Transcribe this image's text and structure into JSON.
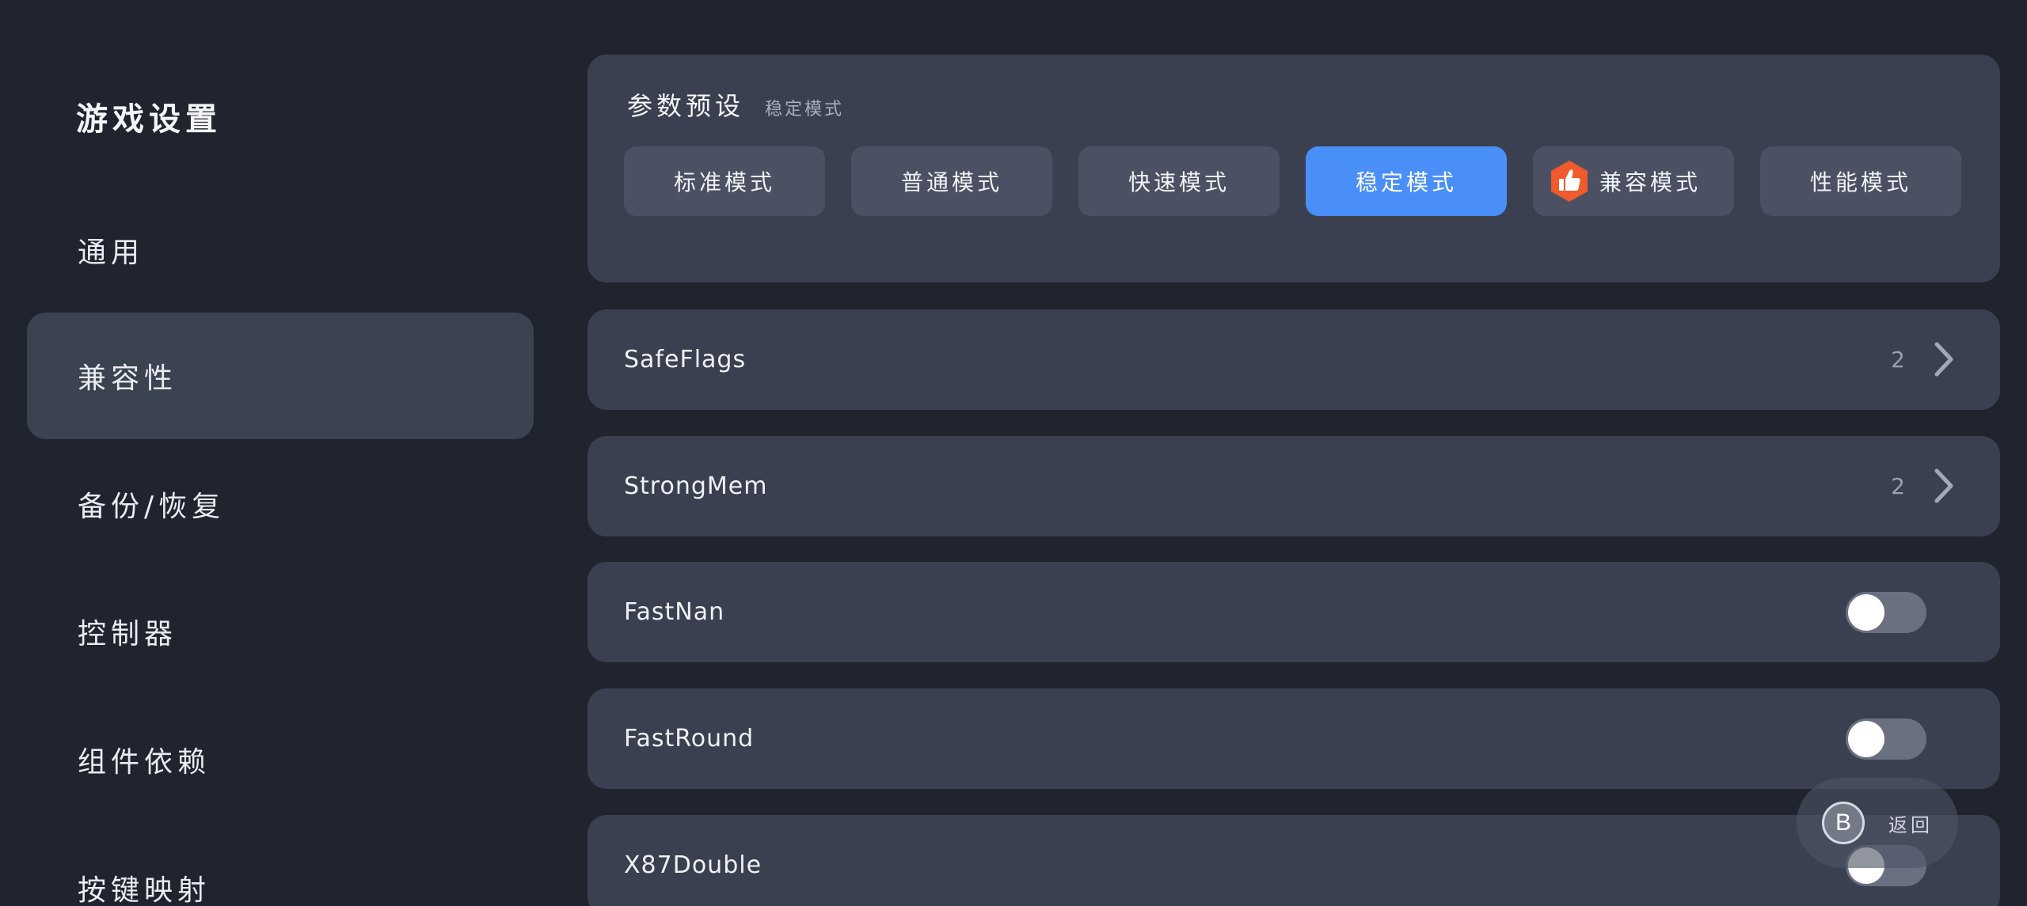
{
  "sidebar": {
    "title": "游戏设置",
    "items": [
      {
        "label": "通用"
      },
      {
        "label": "兼容性",
        "active": true
      },
      {
        "label": "备份/恢复"
      },
      {
        "label": "控制器"
      },
      {
        "label": "组件依赖"
      },
      {
        "label": "按键映射"
      }
    ]
  },
  "presets": {
    "title": "参数预设",
    "current": "稳定模式",
    "options": [
      {
        "label": "标准模式"
      },
      {
        "label": "普通模式"
      },
      {
        "label": "快速模式"
      },
      {
        "label": "稳定模式",
        "selected": true
      },
      {
        "label": "兼容模式",
        "badge": "thumbs-up-icon"
      },
      {
        "label": "性能模式"
      }
    ]
  },
  "settings": [
    {
      "label": "SafeFlags",
      "type": "select",
      "value": "2"
    },
    {
      "label": "StrongMem",
      "type": "select",
      "value": "2"
    },
    {
      "label": "FastNan",
      "type": "toggle",
      "on": false
    },
    {
      "label": "FastRound",
      "type": "toggle",
      "on": false
    },
    {
      "label": "X87Double",
      "type": "toggle",
      "on": false
    }
  ],
  "back": {
    "button_glyph": "B",
    "label": "返回"
  },
  "colors": {
    "background": "#20242e",
    "card": "#3b4050",
    "accent": "#4a8ef7",
    "badge": "#f05a2c"
  }
}
